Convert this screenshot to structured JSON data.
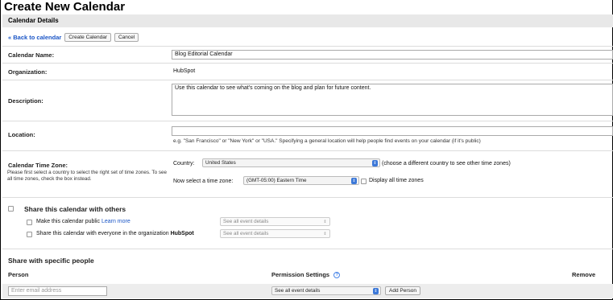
{
  "page": {
    "title": "Create New Calendar"
  },
  "tabs": {
    "details": "Calendar Details"
  },
  "toolbar": {
    "back_label": "« Back to calendar",
    "create_label": "Create Calendar",
    "cancel_label": "Cancel"
  },
  "form": {
    "name_label": "Calendar Name:",
    "name_value": "Blog Editorial Calendar",
    "org_label": "Organization:",
    "org_value": "HubSpot",
    "desc_label": "Description:",
    "desc_value": "Use this calendar to see what's coming on the blog and plan for future content.",
    "location_label": "Location:",
    "location_value": "",
    "location_hint": "e.g. \"San Francisco\" or \"New York\" or \"USA.\" Specifying a general location will help people find events on your calendar (if it's public)",
    "tz_label": "Calendar Time Zone:",
    "tz_help": "Please first select a country to select the right set of time zones. To see all time zones, check the box instead.",
    "country_label": "Country:",
    "country_value": "United States",
    "country_note": "(choose a different country to see other time zones)",
    "tz_select_label": "Now select a time zone:",
    "tz_value": "(GMT-05:00) Eastern Time",
    "display_all_label": "Display all time zones"
  },
  "share": {
    "title": "Share this calendar with others",
    "public_label": "Make this calendar public",
    "learn_more": "Learn more",
    "public_select": "See all event details",
    "org_label_prefix": "Share this calendar with everyone in the organization",
    "org_name": "HubSpot",
    "org_select": "See all event details"
  },
  "people": {
    "title": "Share with specific people",
    "col_person": "Person",
    "col_permission": "Permission Settings",
    "col_remove": "Remove",
    "email_placeholder": "Enter email address",
    "permission_value": "See all event details",
    "add_label": "Add Person"
  }
}
